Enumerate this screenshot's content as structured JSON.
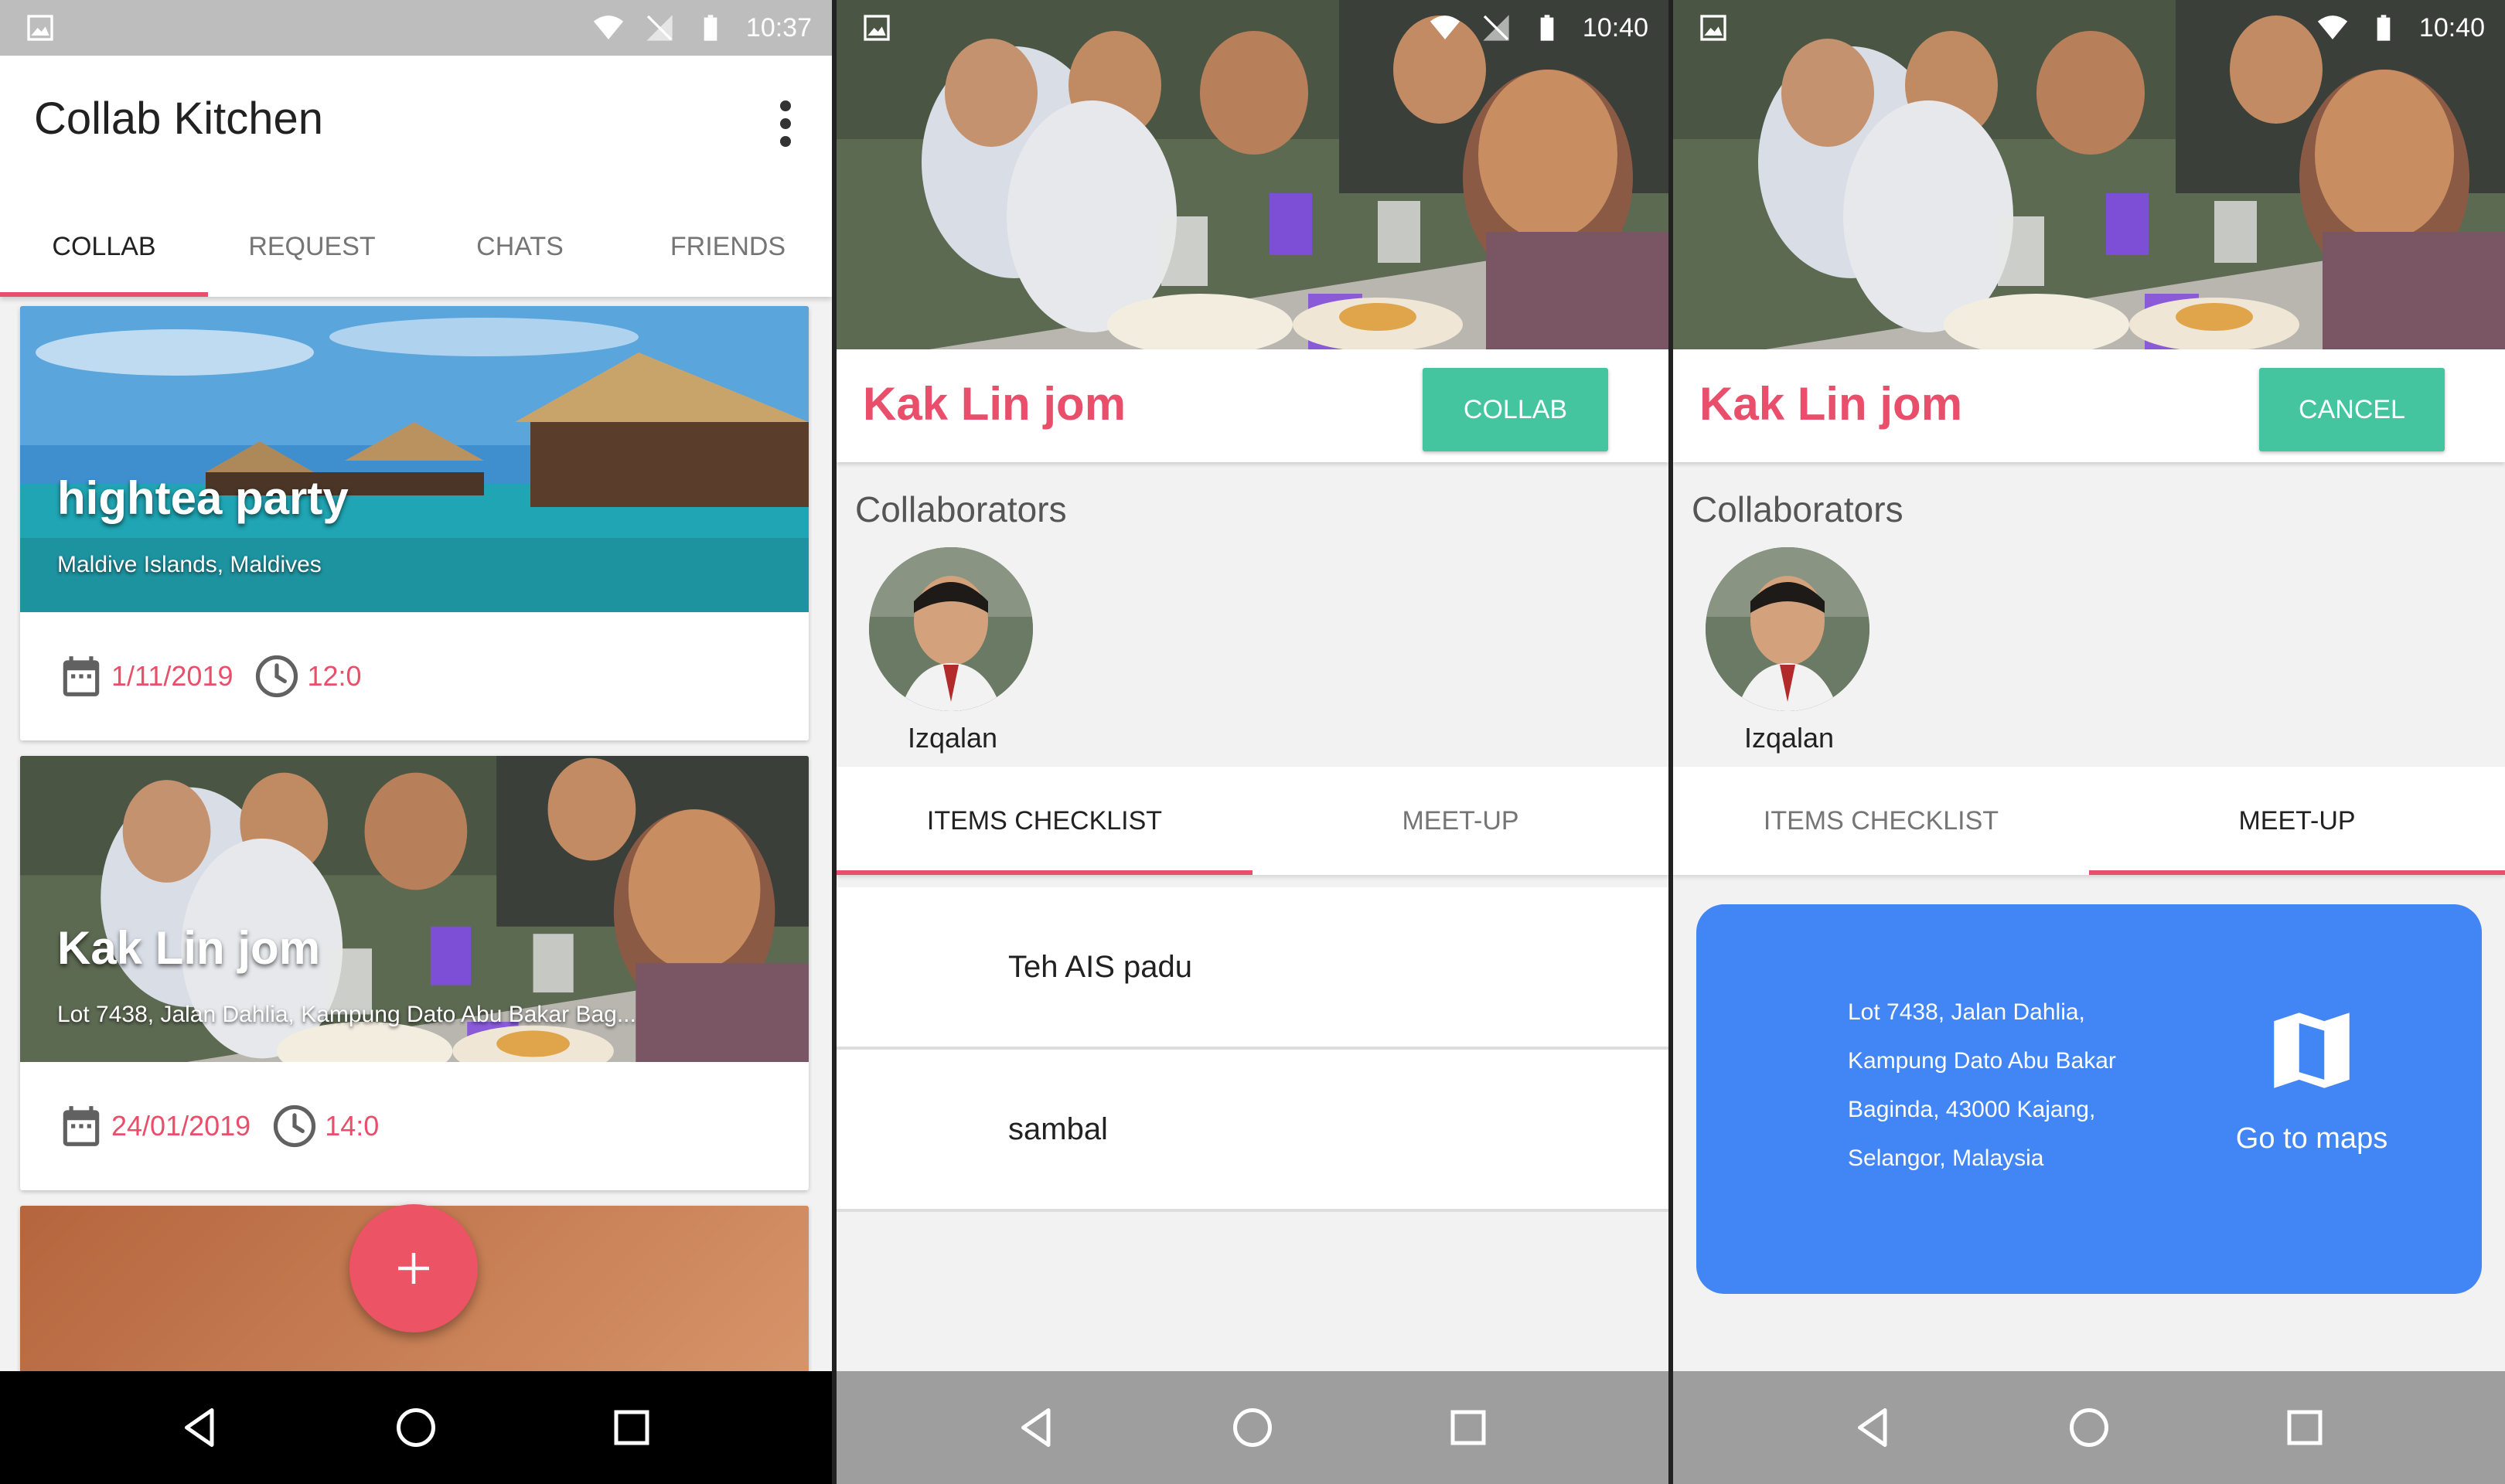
{
  "colors": {
    "accent": "#e94f6b",
    "teal": "#45c4a0",
    "map_blue": "#4285f4"
  },
  "screen1": {
    "status_time": "10:37",
    "app_title": "Collab Kitchen",
    "menu_icon": "more-vert-icon",
    "tabs": [
      {
        "label": "COLLAB",
        "active": true
      },
      {
        "label": "REQUEST",
        "active": false
      },
      {
        "label": "CHATS",
        "active": false
      },
      {
        "label": "FRIENDS",
        "active": false
      }
    ],
    "cards": [
      {
        "title": "hightea party",
        "location": "Maldive Islands, Maldives",
        "date": "1/11/2019",
        "time": "12:0"
      },
      {
        "title": "Kak Lin jom",
        "location": "Lot 7438, Jalan Dahlia, Kampung Dato Abu Bakar Bag...",
        "date": "24/01/2019",
        "time": "14:0"
      }
    ],
    "fab_icon": "add-icon"
  },
  "screen2": {
    "status_time": "10:40",
    "event_title": "Kak Lin jom",
    "action_button": "COLLAB",
    "collaborators_heading": "Collaborators",
    "collaborator_name": "Izqalan",
    "tabs": [
      {
        "label": "ITEMS CHECKLIST",
        "active": true
      },
      {
        "label": "MEET-UP",
        "active": false
      }
    ],
    "checklist": [
      "Teh AIS padu",
      "sambal"
    ]
  },
  "screen3": {
    "status_time": "10:40",
    "event_title": "Kak Lin jom",
    "action_button": "CANCEL",
    "collaborators_heading": "Collaborators",
    "collaborator_name": "Izqalan",
    "tabs": [
      {
        "label": "ITEMS CHECKLIST",
        "active": false
      },
      {
        "label": "MEET-UP",
        "active": true
      }
    ],
    "address_lines": [
      "Lot 7438, Jalan Dahlia,",
      "Kampung Dato Abu Bakar",
      "Baginda, 43000 Kajang,",
      "Selangor, Malaysia"
    ],
    "maps_button": "Go to maps",
    "maps_icon": "map-icon"
  }
}
